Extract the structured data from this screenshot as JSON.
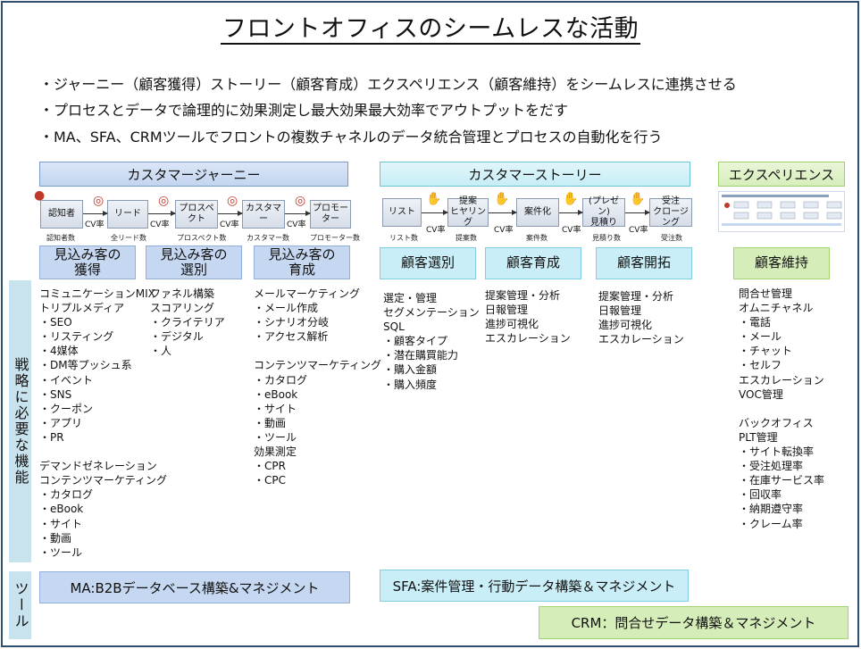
{
  "title": "フロントオフィスのシームレスな活動",
  "bullets": [
    "・ジャーニー（顧客獲得）ストーリー（顧客育成）エクスペリエンス（顧客維持）をシームレスに連携させる",
    "・プロセスとデータで論理的に効果測定し最大効果最大効率でアウトプットをだす",
    "・MA、SFA、CRMツールでフロントの複数チャネルのデータ統合管理とプロセスの自動化を行う"
  ],
  "sections": {
    "journey": "カスタマージャーニー",
    "story": "カスタマーストーリー",
    "experience": "エクスペリエンス"
  },
  "journey_flow": {
    "steps": [
      "認知者",
      "リード",
      "プロスペクト",
      "カスタマー",
      "プロモーター"
    ],
    "counts": [
      "認知者数",
      "全リード数",
      "プロスペクト数",
      "カスタマー数",
      "プロモーター数"
    ],
    "cv": "CV率"
  },
  "story_flow": {
    "steps": [
      "リスト",
      "提案\nヒヤリング",
      "案件化",
      "(プレゼン)\n見積り",
      "受注\nクロージング"
    ],
    "counts": [
      "リスト数",
      "提案数",
      "案件数",
      "見積り数",
      "受注数"
    ],
    "cv": "CV率"
  },
  "subheads": {
    "j1": "見込み客の\n獲得",
    "j2": "見込み客の\n選別",
    "j3": "見込み客の\n育成",
    "s1": "顧客選別",
    "s2": "顧客育成",
    "s3": "顧客開拓",
    "e1": "顧客維持"
  },
  "lists": {
    "j1": [
      "コミュニケーションMIX",
      "トリプルメディア",
      "・SEO",
      "・リスティング",
      "・4媒体",
      "・DM等プッシュ系",
      "・イベント",
      "・SNS",
      "・クーポン",
      "・アプリ",
      "・PR",
      "",
      "デマンドゼネレーション",
      "コンテンツマーケティング",
      "・カタログ",
      "・eBook",
      "・サイト",
      "・動画",
      "・ツール"
    ],
    "j2": [
      "ファネル構築",
      "スコアリング",
      "・クライテリア",
      "・デジタル",
      "・人"
    ],
    "j3": [
      "メールマーケティング",
      "・メール作成",
      "・シナリオ分岐",
      "・アクセス解析",
      "",
      "コンテンツマーケティング",
      "・カタログ",
      "・eBook",
      "・サイト",
      "・動画",
      "・ツール",
      "効果測定",
      "・CPR",
      "・CPC"
    ],
    "s1": [
      "選定・管理",
      "セグメンテーション",
      "SQL",
      "・顧客タイプ",
      "・潜在購買能力",
      "・購入金額",
      "・購入頻度"
    ],
    "s2": [
      "提案管理・分析",
      "日報管理",
      "進捗可視化",
      "エスカレーション"
    ],
    "s3": [
      "提案管理・分析",
      "日報管理",
      "進捗可視化",
      "エスカレーション"
    ],
    "e1": [
      "問合せ管理",
      "オムニチャネル",
      "・電話",
      "・メール",
      "・チャット",
      "・セルフ",
      "エスカレーション",
      "VOC管理",
      "",
      "バックオフィス",
      "PLT管理",
      "・サイト転換率",
      "・受注処理率",
      "・在庫サービス率",
      "・回収率",
      "・納期遵守率",
      "・クレーム率"
    ]
  },
  "side_labels": {
    "strategy": "戦略に必要な機能",
    "tools": "ツール"
  },
  "tools": {
    "ma": "MA:B2Bデータベース構築&マネジメント",
    "sfa": "SFA:案件管理・行動データ構築＆マネジメント",
    "crm": "CRM：問合せデータ構築＆マネジメント"
  },
  "colors": {
    "blue": "#c5d7f1",
    "cyan": "#c9eef7",
    "green": "#d5edb8",
    "side": "#c9e3ee"
  }
}
